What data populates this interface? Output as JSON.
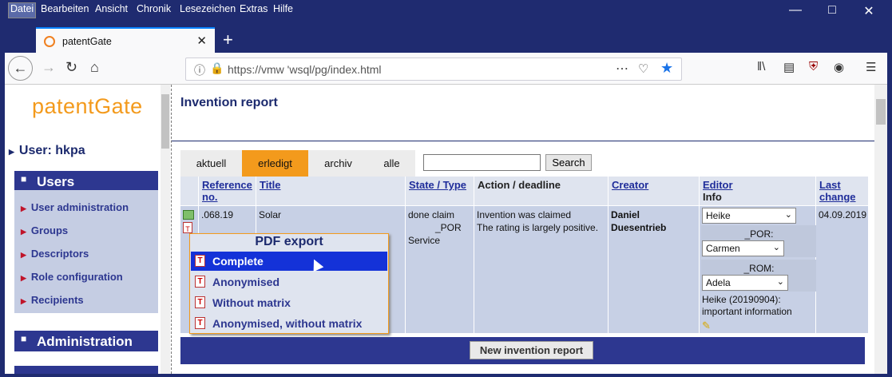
{
  "menu": [
    "Datei",
    "Bearbeiten",
    "Ansicht",
    "Chronik",
    "Lesezeichen",
    "Extras",
    "Hilfe"
  ],
  "browser": {
    "tab_title": "patentGate",
    "url": "https://vmw        'wsql/pg/index.html",
    "new_tab": "+"
  },
  "sidebar": {
    "logo": "patentGate",
    "user": "User: hkpa",
    "sections": [
      {
        "label": "Users",
        "toggle": "-"
      },
      {
        "label": "Administration",
        "toggle": "+"
      }
    ],
    "items": [
      "User administration",
      "Groups",
      "Descriptors",
      "Role configuration",
      "Recipients"
    ]
  },
  "main": {
    "title": "Invention report",
    "tabs": [
      "aktuell",
      "erledigt",
      "archiv",
      "alle"
    ],
    "active_tab": "erledigt",
    "search_value": "",
    "search_button": "Search",
    "columns": [
      {
        "label": "Reference no.",
        "link": true
      },
      {
        "label": "Title",
        "link": true
      },
      {
        "label": "State / Type",
        "link": true
      },
      {
        "label": "Action / deadline",
        "link": false
      },
      {
        "label": "Creator",
        "link": true
      },
      {
        "label": "Editor",
        "sub": "Info",
        "link": true
      },
      {
        "label": "Last change",
        "link": true
      }
    ],
    "row": {
      "reference": ".068.19",
      "title": "Solar",
      "state": "done  claim",
      "state2": "_POR",
      "type": "Service",
      "action": "Invention was claimed",
      "action_note": "The rating is largely positive.",
      "creator": "Daniel Duesentrieb",
      "editor": "Heike",
      "por_label": "_POR:",
      "por_value": "Carmen",
      "rom_label": "_ROM:",
      "rom_value": "Adela",
      "info": "Heike (20190904): important information",
      "last_change": "04.09.2019"
    },
    "pdf_popup": {
      "title": "PDF export",
      "items": [
        "Complete",
        "Anonymised",
        "Without matrix",
        "Anonymised, without matrix"
      ],
      "highlighted": "Complete"
    },
    "new_button": "New invention report"
  },
  "colors": {
    "accent": "#f39a1c",
    "nav": "#2d3790",
    "highlight": "#1432d8"
  }
}
